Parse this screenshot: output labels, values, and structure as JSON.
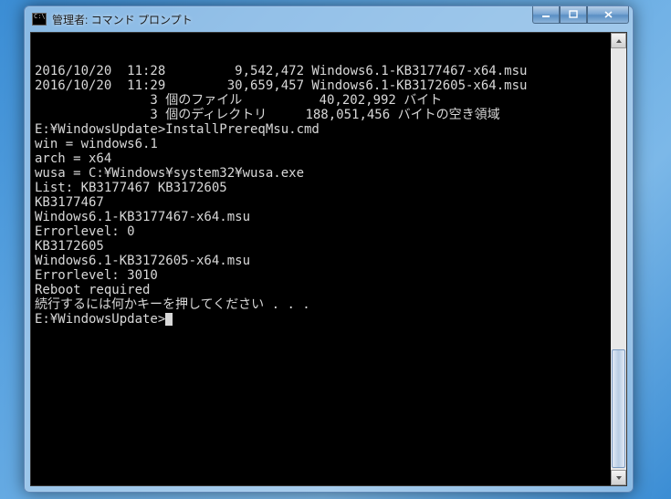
{
  "window": {
    "title": "管理者: コマンド プロンプト"
  },
  "console": {
    "lines": [
      "2016/10/20  11:28         9,542,472 Windows6.1-KB3177467-x64.msu",
      "2016/10/20  11:29        30,659,457 Windows6.1-KB3172605-x64.msu",
      "               3 個のファイル          40,202,992 バイト",
      "               3 個のディレクトリ     188,051,456 バイトの空き領域",
      "",
      "E:¥WindowsUpdate>InstallPrereqMsu.cmd",
      "win = windows6.1",
      "arch = x64",
      "wusa = C:¥Windows¥system32¥wusa.exe",
      "",
      "List: KB3177467 KB3172605",
      "",
      "KB3177467",
      "Windows6.1-KB3177467-x64.msu",
      "Errorlevel: 0",
      "",
      "KB3172605",
      "Windows6.1-KB3172605-x64.msu",
      "Errorlevel: 3010",
      "Reboot required",
      "",
      "",
      "続行するには何かキーを押してください . . .",
      "",
      "E:¥WindowsUpdate>"
    ]
  }
}
